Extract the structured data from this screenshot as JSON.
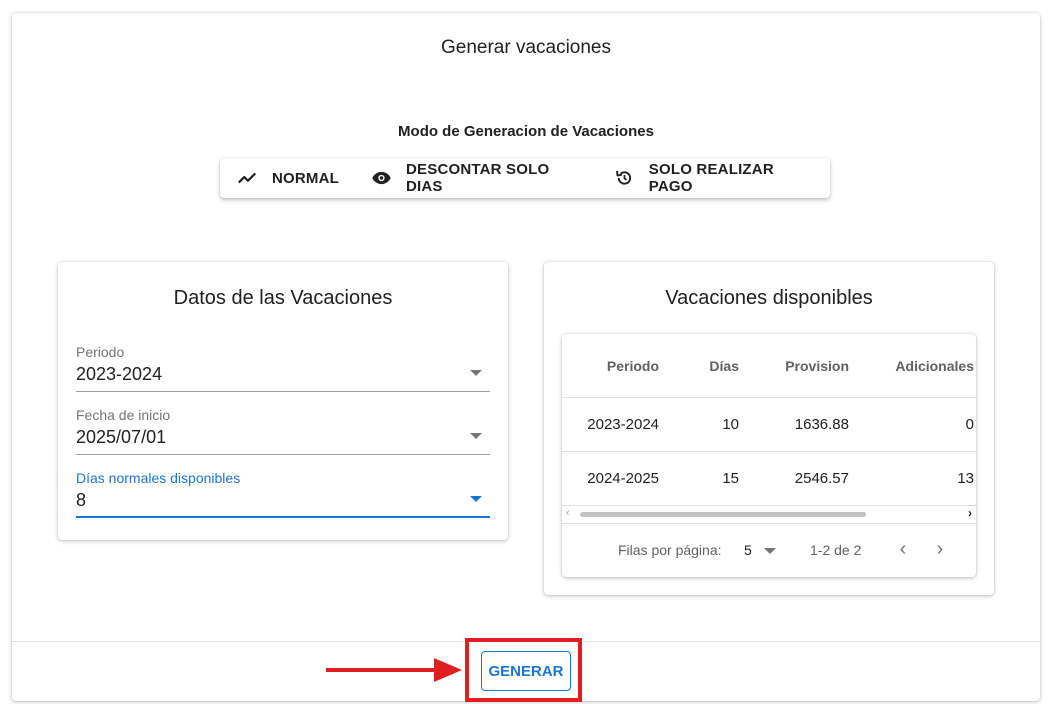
{
  "dialog": {
    "title": "Generar vacaciones",
    "mode_label": "Modo de Generacion de Vacaciones",
    "modes": [
      {
        "label": "NORMAL",
        "icon": "trending-icon"
      },
      {
        "label": "DESCONTAR SOLO DIAS",
        "icon": "eye-icon"
      },
      {
        "label": "SOLO REALIZAR PAGO",
        "icon": "restore-icon"
      }
    ]
  },
  "left_card": {
    "title": "Datos de las Vacaciones",
    "fields": [
      {
        "label": "Periodo",
        "value": "2023-2024"
      },
      {
        "label": "Fecha de inicio",
        "value": "2025/07/01"
      },
      {
        "label": "Días normales disponibles",
        "value": "8"
      }
    ]
  },
  "right_card": {
    "title": "Vacaciones disponibles",
    "columns": [
      "Periodo",
      "Días",
      "Provision",
      "Adicionales"
    ],
    "rows": [
      [
        "2023-2024",
        "10",
        "1636.88",
        "0"
      ],
      [
        "2024-2025",
        "15",
        "2546.57",
        "13"
      ]
    ],
    "pagination": {
      "rows_per_page_label": "Filas por página:",
      "rows_per_page": "5",
      "range": "1-2 de 2"
    }
  },
  "footer": {
    "generate_label": "GENERAR"
  },
  "colors": {
    "primary": "#1976d2",
    "highlight": "#e02020"
  }
}
